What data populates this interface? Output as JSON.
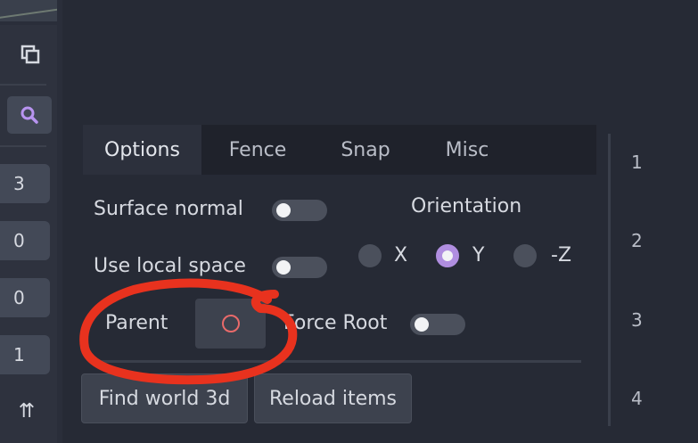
{
  "sidebar": {
    "icons": [
      {
        "name": "copy-icon"
      },
      {
        "name": "search-icon"
      },
      {
        "name": "collapse-icon",
        "glyph": "⇈"
      }
    ],
    "values": [
      "3",
      "0",
      "0",
      "1"
    ]
  },
  "tabs": {
    "options": "Options",
    "fence": "Fence",
    "snap": "Snap",
    "misc": "Misc",
    "active": "Options"
  },
  "options": {
    "surface_normal": {
      "label": "Surface normal",
      "on": false
    },
    "use_local_space": {
      "label": "Use local space",
      "on": false
    },
    "orientation": {
      "title": "Orientation",
      "x": "X",
      "y": "Y",
      "neg_z": "-Z",
      "selected": "Y"
    },
    "parent": {
      "label": "Parent"
    },
    "force_root": {
      "label": "Force Root",
      "on": false
    }
  },
  "actions": {
    "find_world": "Find world 3d",
    "reload_items": "Reload items"
  },
  "ruler": [
    "1",
    "2",
    "3",
    "4"
  ],
  "colors": {
    "accent": "#b08ee0",
    "annotation": "#e8321e",
    "parent_icon": "#e96a6a"
  }
}
